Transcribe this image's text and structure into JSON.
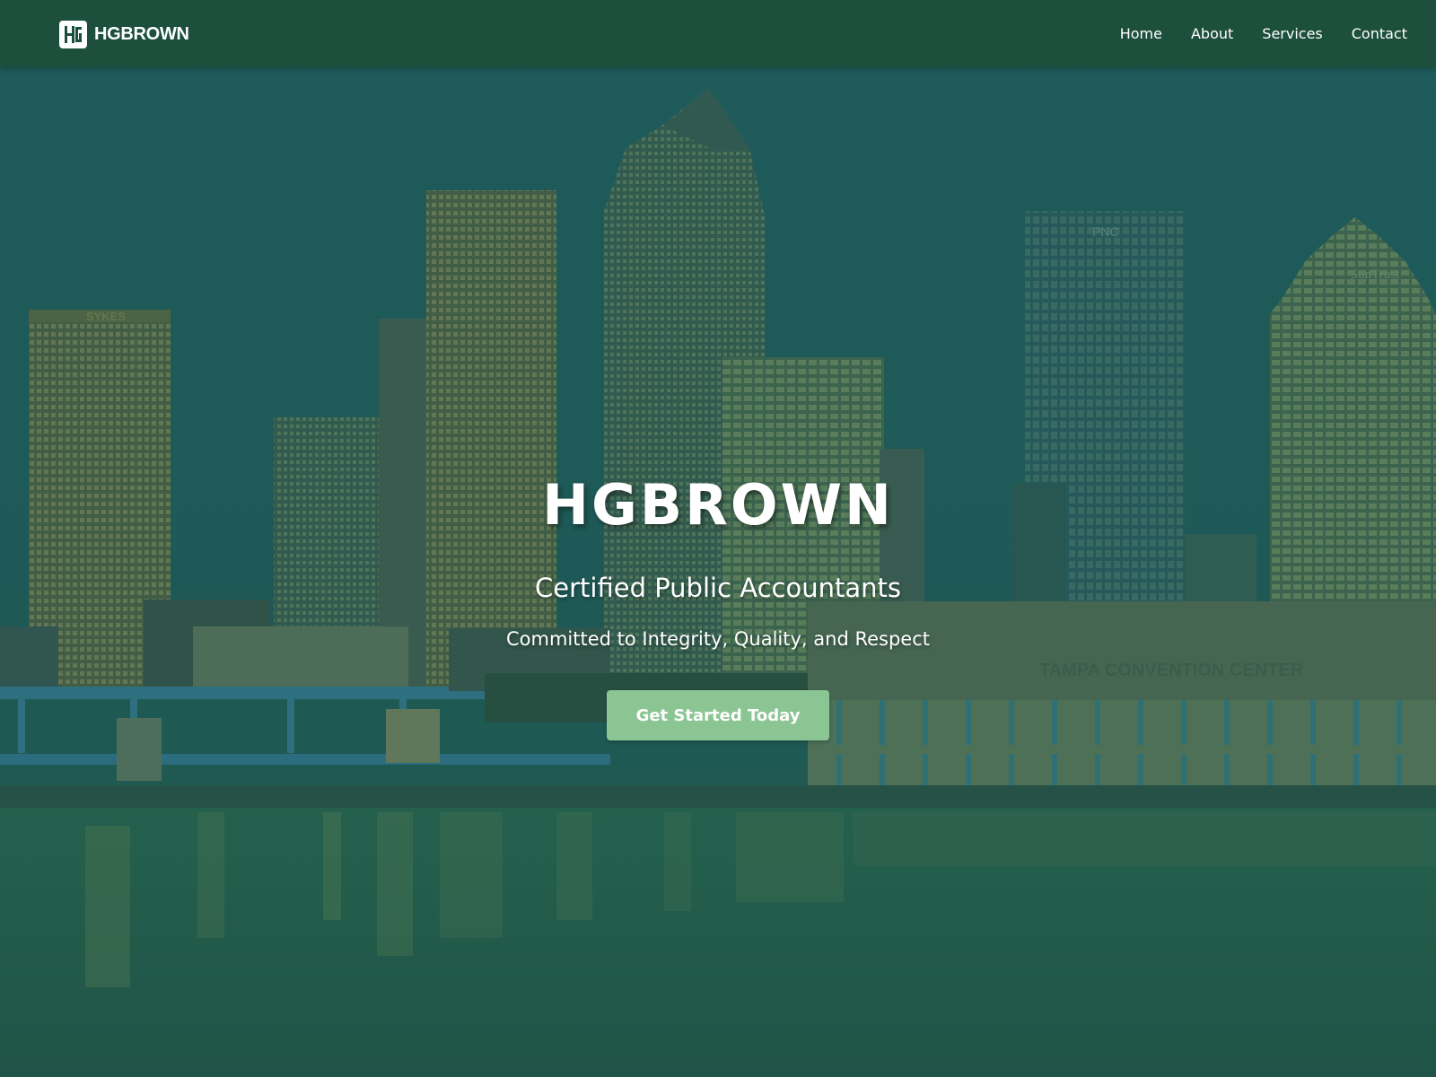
{
  "nav": {
    "brand": {
      "logo_icon": "hb-monogram-icon",
      "name": "HGBROWN"
    },
    "links": [
      {
        "label": "Home"
      },
      {
        "label": "About"
      },
      {
        "label": "Services"
      },
      {
        "label": "Contact"
      }
    ],
    "background_color": "#1c4f3c"
  },
  "hero": {
    "title": "HGBROWN",
    "subtitle": "Certified Public Accountants",
    "tagline": "Committed to Integrity, Quality, and Respect",
    "cta_label": "Get Started Today",
    "cta_color": "#8cc594",
    "overlay_color": "#1d5a4a",
    "background_image": {
      "signs": {
        "sykes": "SYKES",
        "pnc": "PNC",
        "suntrust": "SunTrust",
        "convention_center": "TAMPA CONVENTION CENTER"
      }
    }
  }
}
